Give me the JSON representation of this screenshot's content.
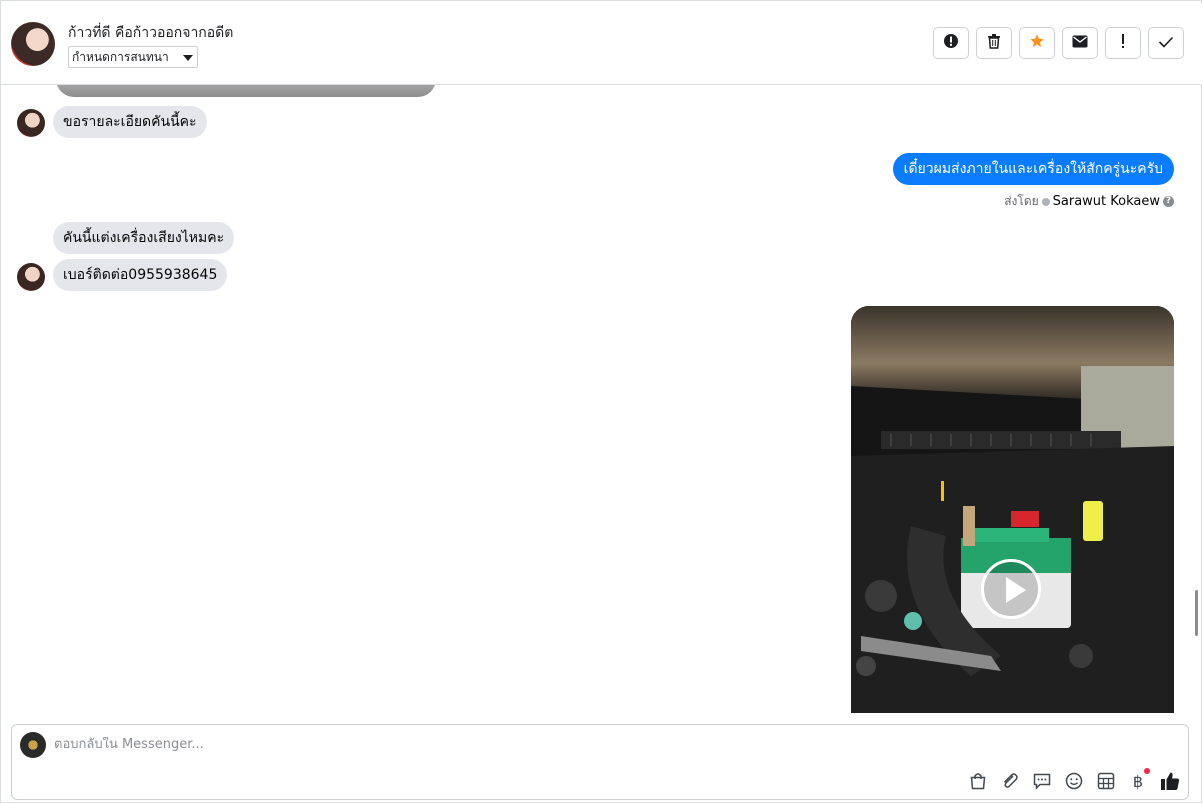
{
  "header": {
    "name": "ก้าวที่ดี คือก้าวออกจากอดีต",
    "assign_label": "กำหนดการสนทนา",
    "actions": [
      {
        "name": "report-spam-icon",
        "glyph": "!"
      },
      {
        "name": "delete-icon",
        "glyph": ""
      },
      {
        "name": "star-icon",
        "glyph": ""
      },
      {
        "name": "mark-unread-icon",
        "glyph": ""
      },
      {
        "name": "important-icon",
        "glyph": "!"
      },
      {
        "name": "done-check-icon",
        "glyph": ""
      }
    ],
    "star_color": "#f7931e"
  },
  "thread": {
    "messages": [
      {
        "side": "in",
        "text": "ขอรายละเอียดคันนี้คะ"
      },
      {
        "side": "out",
        "text": "เดี๋ยวผมส่งภายในและเครื่องให้สักครู่นะครับ"
      },
      {
        "side": "in",
        "text": "คันนี้แต่งเครื่องเสียงไหมคะ"
      },
      {
        "side": "in",
        "text": "เบอร์ติดต่อ0955938645"
      }
    ],
    "sent_by_label": "ส่งโดย",
    "sent_by_name": "Sarawut Kokaew",
    "video_icon": "play-icon",
    "accent_color": "#0a7cff"
  },
  "composer": {
    "placeholder": "ตอบกลับใน Messenger...",
    "tools": [
      "shopping-bag-icon",
      "attachment-icon",
      "saved-reply-icon",
      "emoji-icon",
      "table-icon",
      "baht-icon",
      "thumbs-up-icon"
    ],
    "baht_glyph": "฿"
  }
}
